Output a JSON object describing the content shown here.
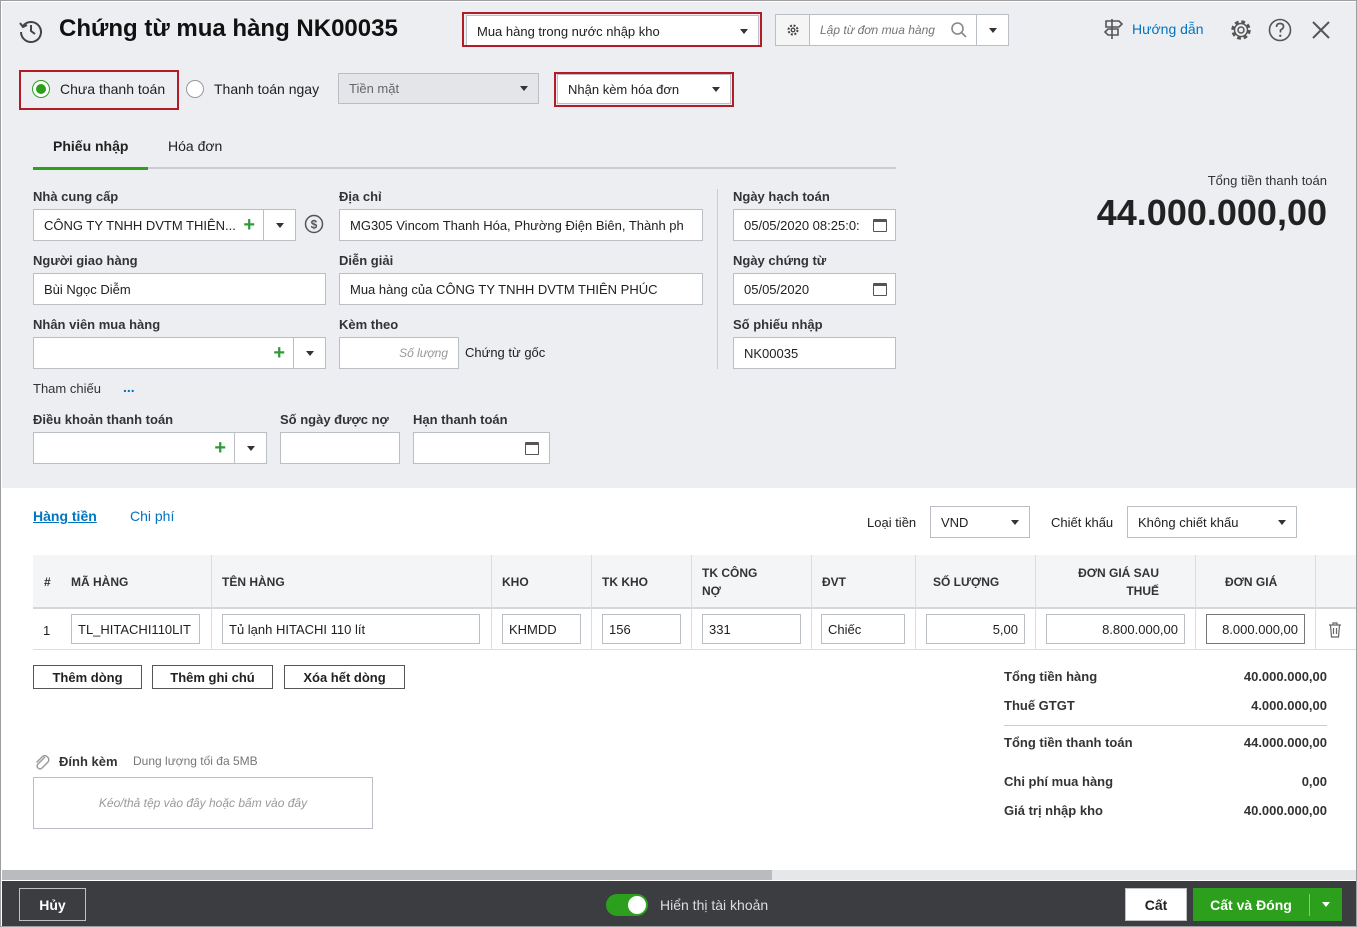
{
  "header": {
    "title": "Chứng từ mua hàng NK00035",
    "voucher_type": "Mua hàng trong nước nhập kho",
    "search_placeholder": "Lập từ đơn mua hàng",
    "help_label": "Hướng dẫn"
  },
  "payment": {
    "unpaid_label": "Chưa thanh toán",
    "pay_now_label": "Thanh toán ngay",
    "method": "Tiền mặt",
    "invoice_option": "Nhận kèm hóa đơn"
  },
  "tabs": {
    "receipt": "Phiếu nhập",
    "invoice": "Hóa đơn"
  },
  "form": {
    "supplier_label": "Nhà cung cấp",
    "supplier_value": "CÔNG TY TNHH DVTM THIÊN...",
    "address_label": "Địa chỉ",
    "address_value": "MG305 Vincom Thanh Hóa, Phường Điện Biên, Thành ph",
    "posting_date_label": "Ngày hạch toán",
    "posting_date_value": "05/05/2020 08:25:0:",
    "deliverer_label": "Người giao hàng",
    "deliverer_value": "Bùi Ngọc Diễm",
    "description_label": "Diễn giải",
    "description_value": "Mua hàng của CÔNG TY TNHH DVTM THIÊN PHÚC",
    "voucher_date_label": "Ngày chứng từ",
    "voucher_date_value": "05/05/2020",
    "buyer_label": "Nhân viên mua hàng",
    "attach_label": "Kèm theo",
    "attach_placeholder": "Số lượng",
    "attach_suffix": "Chứng từ gốc",
    "receipt_no_label": "Số phiếu nhập",
    "receipt_no_value": "NK00035",
    "reference_label": "Tham chiếu",
    "reference_more": "...",
    "payment_terms_label": "Điều khoản thanh toán",
    "credit_days_label": "Số ngày được nợ",
    "due_date_label": "Hạn thanh toán"
  },
  "total": {
    "label": "Tổng tiền thanh toán",
    "value": "44.000.000,00"
  },
  "detail_tabs": {
    "goods": "Hàng tiền",
    "cost": "Chi phí"
  },
  "currency": {
    "label": "Loại tiền",
    "value": "VND"
  },
  "discount": {
    "label": "Chiết khấu",
    "value": "Không chiết khấu"
  },
  "table": {
    "headers": {
      "no": "#",
      "code": "MÃ HÀNG",
      "name": "TÊN HÀNG",
      "warehouse": "KHO",
      "stock_acc": "TK KHO",
      "payable_acc_1": "TK CÔNG",
      "payable_acc_2": "NỢ",
      "unit": "ĐVT",
      "qty": "SỐ LƯỢNG",
      "price_after_tax_1": "ĐƠN GIÁ SAU",
      "price_after_tax_2": "THUẾ",
      "price": "ĐƠN GIÁ"
    },
    "rows": [
      {
        "no": "1",
        "code": "TL_HITACHI110LIT",
        "name": "Tủ lạnh HITACHI 110 lít",
        "warehouse": "KHMDD",
        "stock_acc": "156",
        "payable_acc": "331",
        "unit": "Chiếc",
        "qty": "5,00",
        "price_after_tax": "8.800.000,00",
        "price": "8.000.000,00"
      }
    ]
  },
  "row_buttons": {
    "add_row": "Thêm dòng",
    "add_note": "Thêm ghi chú",
    "delete_all": "Xóa hết dòng"
  },
  "summary": [
    {
      "label": "Tổng tiền hàng",
      "value": "40.000.000,00"
    },
    {
      "label": "Thuế GTGT",
      "value": "4.000.000,00"
    },
    {
      "label": "Tổng tiền thanh toán",
      "value": "44.000.000,00"
    },
    {
      "label": "Chi phí mua hàng",
      "value": "0,00"
    },
    {
      "label": "Giá trị nhập kho",
      "value": "40.000.000,00"
    }
  ],
  "attachment": {
    "label": "Đính kèm",
    "limit": "Dung lượng tối đa 5MB",
    "drop_hint": "Kéo/thả tệp vào đây hoặc bấm vào đây"
  },
  "footer": {
    "cancel": "Hủy",
    "show_account": "Hiển thị tài khoản",
    "save": "Cất",
    "save_close": "Cất và Đóng"
  },
  "colors": {
    "accent": "#2ca01c",
    "red_box": "#b11c26",
    "link": "#0075c0",
    "footer_bg": "#3b3d40"
  }
}
